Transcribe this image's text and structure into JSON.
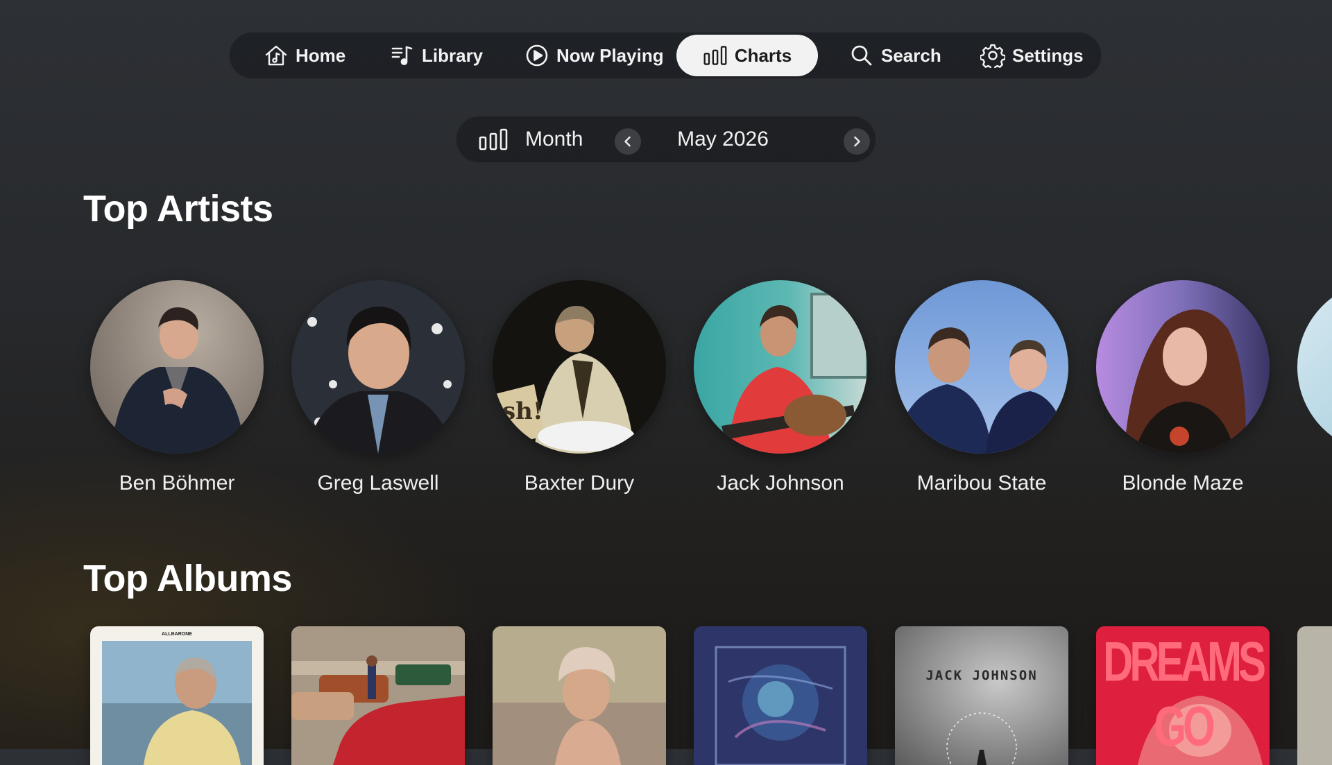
{
  "nav": {
    "items": [
      {
        "label": "Home",
        "icon": "home-icon"
      },
      {
        "label": "Library",
        "icon": "music-list-icon"
      },
      {
        "label": "Now Playing",
        "icon": "play-circle-icon"
      },
      {
        "label": "Charts",
        "icon": "bar-chart-icon",
        "active": true
      },
      {
        "label": "Search",
        "icon": "search-icon"
      },
      {
        "label": "Settings",
        "icon": "gear-icon"
      }
    ]
  },
  "period": {
    "unit": "Month",
    "date": "May 2026"
  },
  "sections": {
    "artists_title": "Top Artists",
    "albums_title": "Top Albums"
  },
  "artists": [
    {
      "name": "Ben Böhmer"
    },
    {
      "name": "Greg Laswell"
    },
    {
      "name": "Baxter Dury"
    },
    {
      "name": "Jack Johnson"
    },
    {
      "name": "Maribou State"
    },
    {
      "name": "Blonde Maze"
    }
  ],
  "albums": [
    {
      "cover_text": "ALLBARONE"
    },
    {
      "cover_text": ""
    },
    {
      "cover_text": ""
    },
    {
      "cover_text": ""
    },
    {
      "cover_text": "JACK JOHNSON"
    },
    {
      "cover_text": "DREAMS GO"
    }
  ],
  "colors": {
    "active_tab_bg": "#f2f2f2",
    "dreams_go_red": "#e01e3c"
  }
}
